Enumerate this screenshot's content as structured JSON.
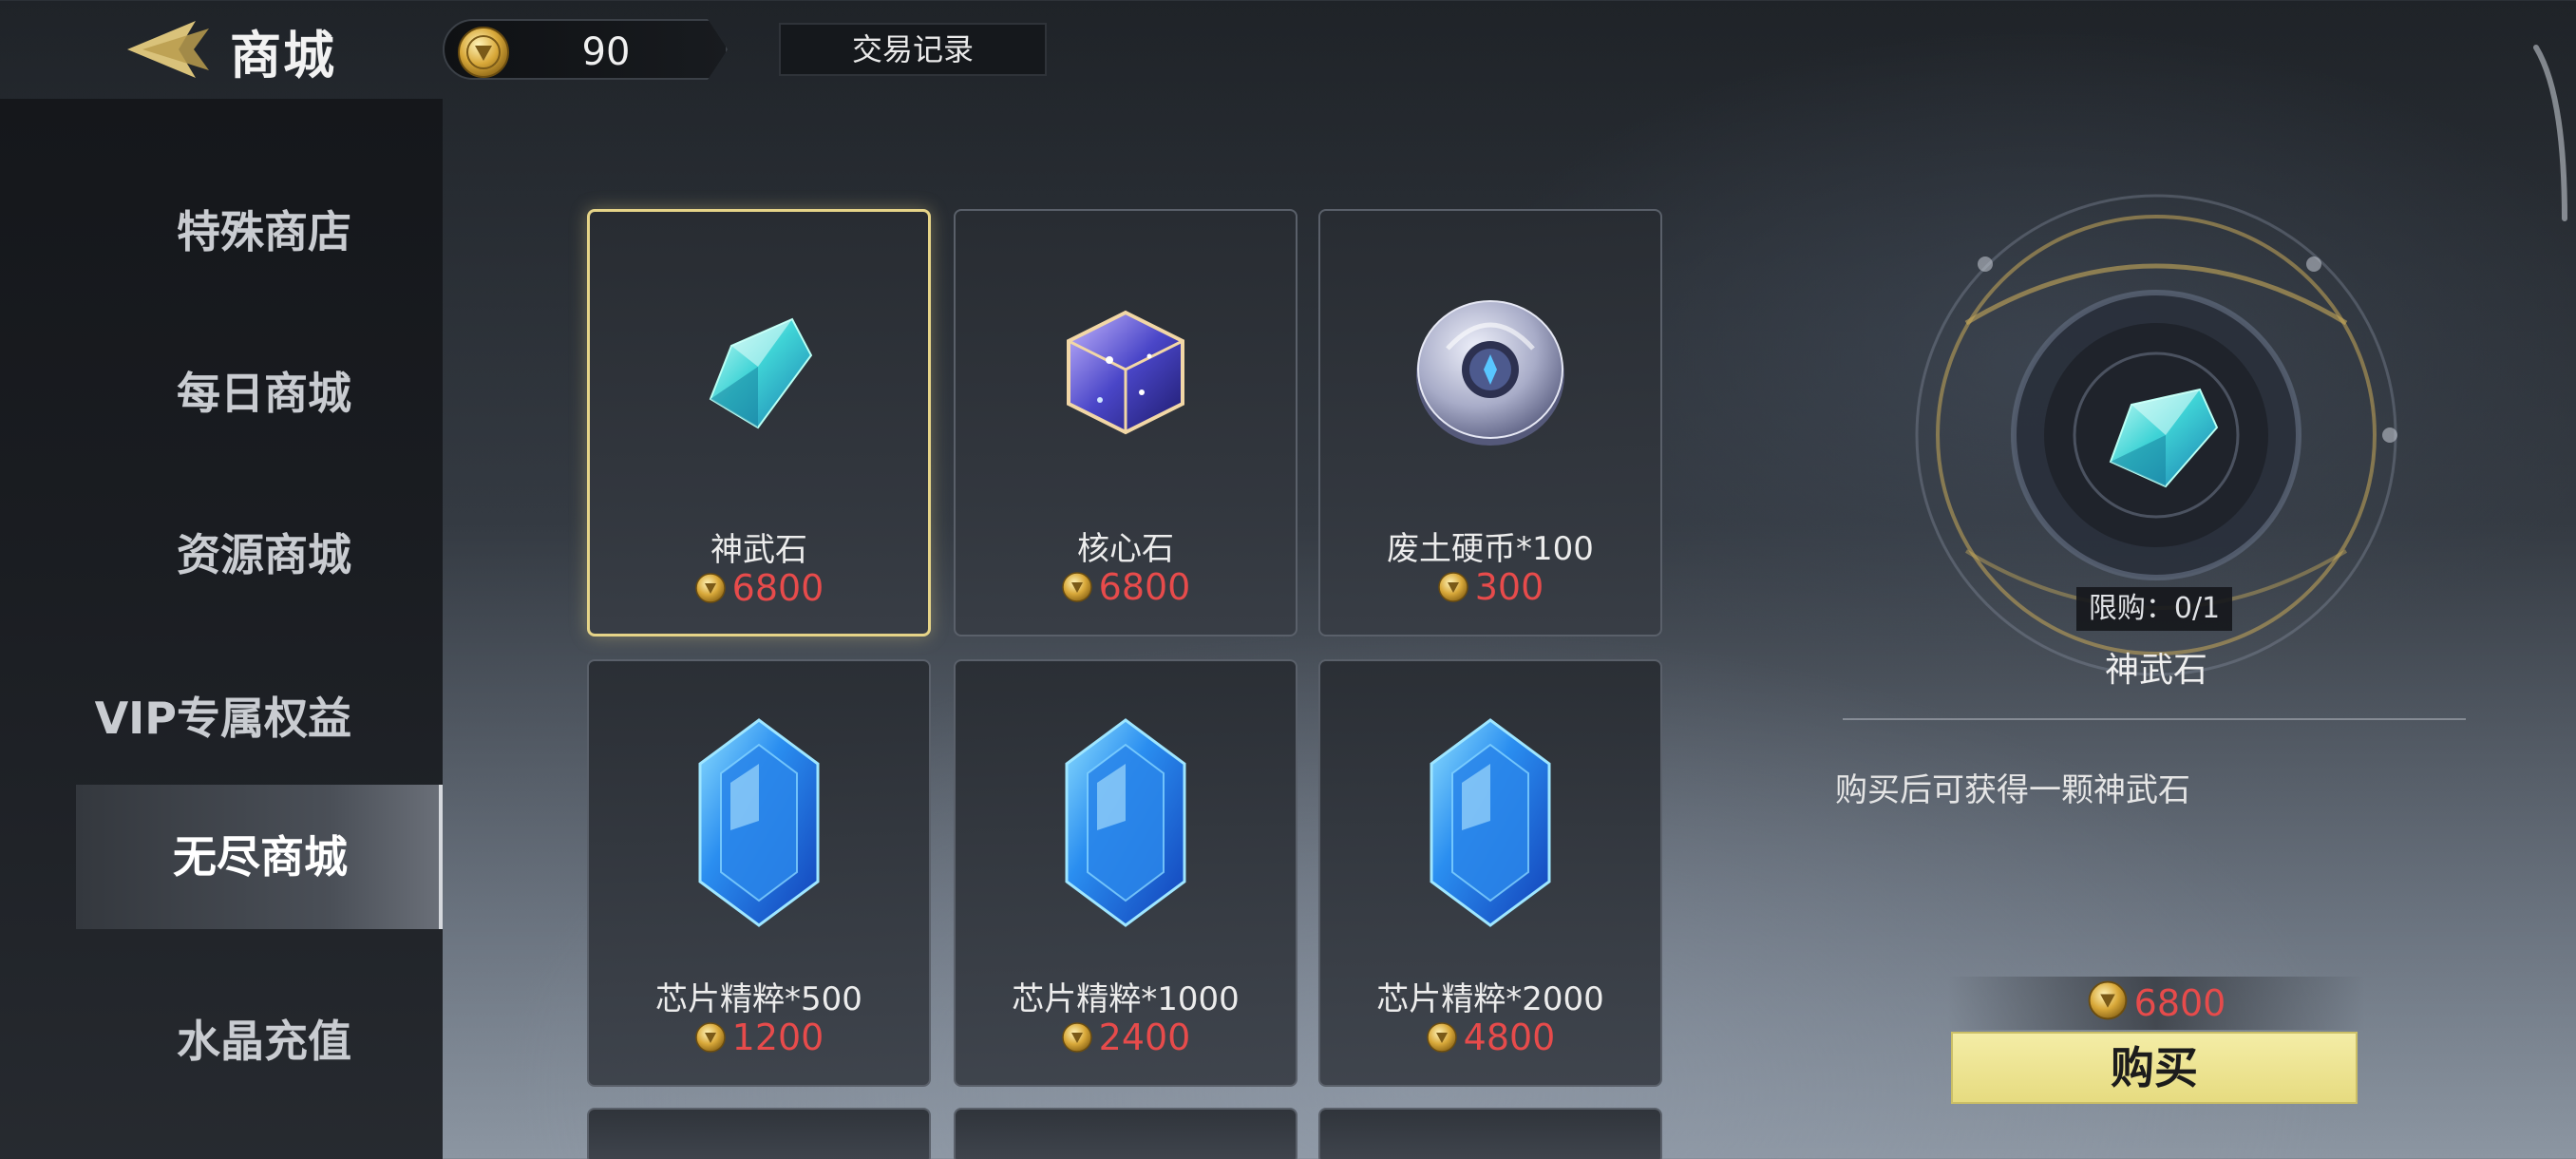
{
  "header": {
    "title": "商城",
    "currency_amount": "90",
    "transaction_label": "交易记录"
  },
  "sidebar": {
    "items": [
      {
        "label": "特殊商店"
      },
      {
        "label": "每日商城"
      },
      {
        "label": "资源商城"
      },
      {
        "label": "VIP专属权益"
      },
      {
        "label": "无尽商城",
        "active": true
      },
      {
        "label": "水晶充值"
      }
    ]
  },
  "items": [
    {
      "name": "神武石",
      "price": "6800",
      "icon": "cyan-crystal-icon",
      "selected": true
    },
    {
      "name": "核心石",
      "price": "6800",
      "icon": "core-cube-icon"
    },
    {
      "name": "废土硬币*100",
      "price": "300",
      "icon": "silver-coin-icon"
    },
    {
      "name": "芯片精粹*500",
      "price": "1200",
      "icon": "blue-gem-icon"
    },
    {
      "name": "芯片精粹*1000",
      "price": "2400",
      "icon": "blue-gem-icon"
    },
    {
      "name": "芯片精粹*2000",
      "price": "4800",
      "icon": "blue-gem-icon"
    }
  ],
  "detail": {
    "limit_text": "限购：0/1",
    "name": "神武石",
    "description": "购买后可获得一颗神武石",
    "price": "6800",
    "buy_label": "购买"
  },
  "colors": {
    "price_red": "#e74b4b",
    "selected_border": "#e6d488",
    "buy_button": "#f2eaa0"
  }
}
